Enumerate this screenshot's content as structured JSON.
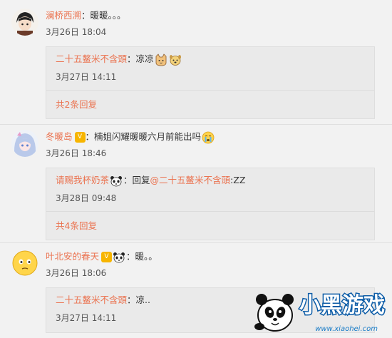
{
  "comments": [
    {
      "user": "澜桥西溯",
      "text": "：暖暖。。。",
      "time": "3月26日 18:04",
      "reply": {
        "user": "二十五鳌米不含頭",
        "text": "：凉凉",
        "time": "3月27日 14:11",
        "more": "共2条回复"
      }
    },
    {
      "user": "冬暖岛",
      "badge": "V",
      "text": "：楠姐闪耀暖暖六月前能出吗",
      "time": "3月26日 18:46",
      "reply": {
        "user": "请赐我杯奶茶",
        "text": "：回复",
        "mention": "@二十五鳌米不含頭",
        "text2": ":ZZ",
        "time": "3月28日 09:48",
        "more": "共4条回复"
      }
    },
    {
      "user": "叶北安的春天",
      "badge": "V",
      "text": "：暖。。",
      "time": "3月26日 18:06",
      "reply": {
        "user": "二十五鳌米不含頭",
        "text": "：凉..",
        "time": "3月27日 14:11"
      }
    }
  ],
  "watermark": {
    "text": "小黑游戏",
    "url": "www.xiaohei.com"
  },
  "colors": {
    "username": "#eb7350",
    "background": "#f2f2f2",
    "reply_bg": "#eaeaea"
  }
}
